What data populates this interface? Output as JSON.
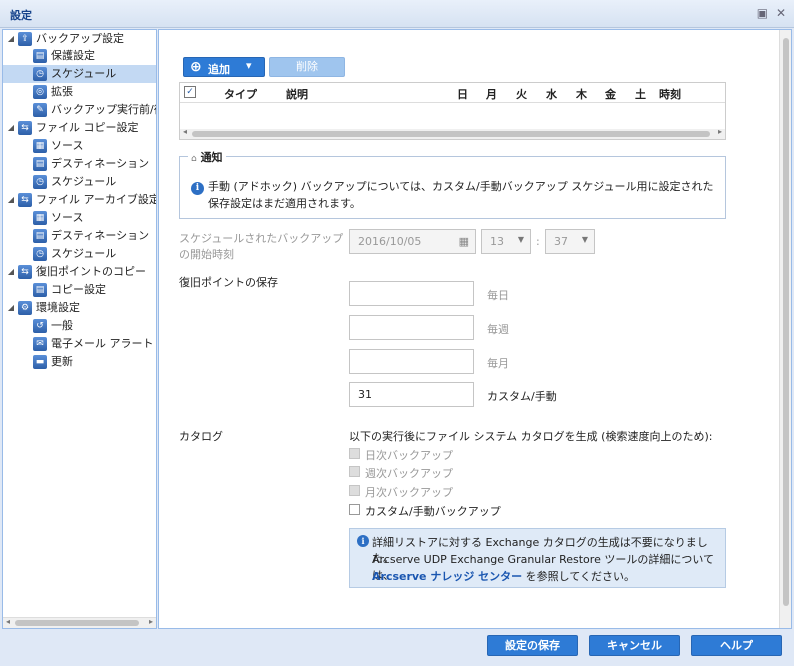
{
  "window": {
    "title": "設定",
    "restore_icon": "▣",
    "close_icon": "✕"
  },
  "sidebar": {
    "items": [
      {
        "label": "バックアップ設定",
        "icon": "backup-icon",
        "glyph": "⇪"
      },
      {
        "label": "保護設定",
        "icon": "protect-icon",
        "glyph": "▤"
      },
      {
        "label": "スケジュール",
        "icon": "schedule-icon",
        "glyph": "◷"
      },
      {
        "label": "拡張",
        "icon": "advanced-icon",
        "glyph": "◎"
      },
      {
        "label": "バックアップ実行前/後",
        "icon": "wrench-icon",
        "glyph": "✎"
      },
      {
        "label": "ファイル コピー設定",
        "icon": "file-copy-icon",
        "glyph": "⇆"
      },
      {
        "label": "ソース",
        "icon": "source-icon",
        "glyph": "▦"
      },
      {
        "label": "デスティネーション",
        "icon": "destination-icon",
        "glyph": "▤"
      },
      {
        "label": "スケジュール",
        "icon": "schedule-icon",
        "glyph": "◷"
      },
      {
        "label": "ファイル アーカイブ設定",
        "icon": "file-archive-icon",
        "glyph": "⇆"
      },
      {
        "label": "ソース",
        "icon": "source-icon",
        "glyph": "▦"
      },
      {
        "label": "デスティネーション",
        "icon": "destination-icon",
        "glyph": "▤"
      },
      {
        "label": "スケジュール",
        "icon": "schedule-icon",
        "glyph": "◷"
      },
      {
        "label": "復旧ポイントのコピー",
        "icon": "recovery-copy-icon",
        "glyph": "⇆"
      },
      {
        "label": "コピー設定",
        "icon": "copy-settings-icon",
        "glyph": "▤"
      },
      {
        "label": "環境設定",
        "icon": "preferences-icon",
        "glyph": "⚙"
      },
      {
        "label": "一般",
        "icon": "general-icon",
        "glyph": "↺"
      },
      {
        "label": "電子メール アラート",
        "icon": "email-icon",
        "glyph": "✉"
      },
      {
        "label": "更新",
        "icon": "update-icon",
        "glyph": "▬"
      }
    ]
  },
  "toolbar": {
    "add_label": "追加",
    "add_icon": "⊕",
    "dropdown_icon": "▾",
    "delete_label": "削除"
  },
  "grid": {
    "checkbox_mark": "✓",
    "columns": [
      "タイプ",
      "説明",
      "日",
      "月",
      "火",
      "水",
      "木",
      "金",
      "土",
      "時刻"
    ]
  },
  "notice": {
    "legend_icon": "⌂",
    "legend": "通知",
    "text": "手動 (アドホック) バックアップについては、カスタム/手動バックアップ スケジュール用に設定された保存設定はまだ適用されます。"
  },
  "schedule_start": {
    "label": "スケジュールされたバックアップの開始時刻",
    "date": "2016/10/05",
    "hour": "13",
    "colon": ":",
    "minute": "37"
  },
  "retention": {
    "label": "復旧ポイントの保存",
    "daily_label": "毎日",
    "daily_value": "",
    "weekly_label": "毎週",
    "weekly_value": "",
    "monthly_label": "毎月",
    "monthly_value": "",
    "custom_label": "カスタム/手動",
    "custom_value": "31"
  },
  "catalog": {
    "label": "カタログ",
    "description": "以下の実行後にファイル システム カタログを生成 (検索速度向上のため):",
    "options": [
      "日次バックアップ",
      "週次バックアップ",
      "月次バックアップ",
      "カスタム/手動バックアップ"
    ]
  },
  "info": {
    "line1": "詳細リストアに対する Exchange カタログの生成は不要になりました。",
    "line2": "Arcserve UDP Exchange Granular Restore ツールの詳細については、",
    "link": "Arcserve ナレッジ センター",
    "line3_suffix": " を参照してください。"
  },
  "footer": {
    "save": "設定の保存",
    "cancel": "キャンセル",
    "help": "ヘルプ"
  }
}
